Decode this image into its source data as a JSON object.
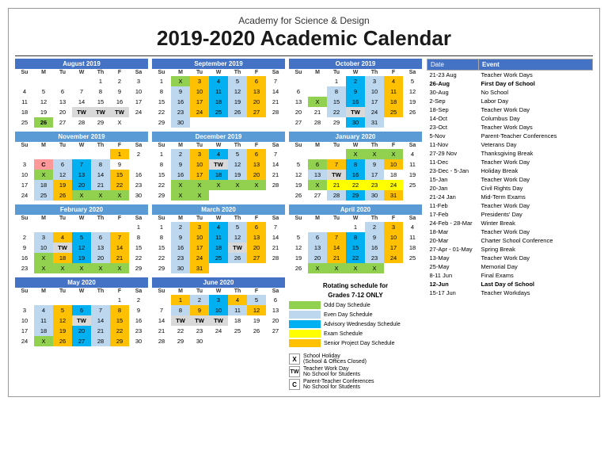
{
  "header": {
    "subtitle": "Academy for Science & Design",
    "title": "2019-2020 Academic Calendar"
  },
  "events": [
    {
      "date": "21-23 Aug",
      "event": "Teacher Work Days",
      "bold": false
    },
    {
      "date": "26-Aug",
      "event": "First Day of School",
      "bold": true
    },
    {
      "date": "30-Aug",
      "event": "No School",
      "bold": false
    },
    {
      "date": "2-Sep",
      "event": "Labor Day",
      "bold": false
    },
    {
      "date": "18-Sep",
      "event": "Teacher Work Day",
      "bold": false
    },
    {
      "date": "14-Oct",
      "event": "Columbus Day",
      "bold": false
    },
    {
      "date": "23-Oct",
      "event": "Teacher Work Days",
      "bold": false
    },
    {
      "date": "5-Nov",
      "event": "Parent-Teacher Conferences",
      "bold": false
    },
    {
      "date": "11-Nov",
      "event": "Veterans Day",
      "bold": false
    },
    {
      "date": "27-29 Nov",
      "event": "Thanksgiving Break",
      "bold": false
    },
    {
      "date": "11-Dec",
      "event": "Teacher Work Day",
      "bold": false
    },
    {
      "date": "23-Dec - 5-Jan",
      "event": "Holiday Break",
      "bold": false
    },
    {
      "date": "15-Jan",
      "event": "Teacher Work Day",
      "bold": false
    },
    {
      "date": "20-Jan",
      "event": "Civil Rights Day",
      "bold": false
    },
    {
      "date": "21-24 Jan",
      "event": "Mid-Term Exams",
      "bold": false
    },
    {
      "date": "11-Feb",
      "event": "Teacher Work Day",
      "bold": false
    },
    {
      "date": "17-Feb",
      "event": "Presidents' Day",
      "bold": false
    },
    {
      "date": "24-Feb - 28-Mar",
      "event": "Winter Break",
      "bold": false
    },
    {
      "date": "18-Mar",
      "event": "Teacher Work Day",
      "bold": false
    },
    {
      "date": "20-Mar",
      "event": "Charter School Conference",
      "bold": false
    },
    {
      "date": "27-Apr - 01-May",
      "event": "Spring Break",
      "bold": false
    },
    {
      "date": "13-May",
      "event": "Teacher Work Day",
      "bold": false
    },
    {
      "date": "25-May",
      "event": "Memorial Day",
      "bold": false
    },
    {
      "date": "8-11 Jun",
      "event": "Final Exams",
      "bold": false
    },
    {
      "date": "12-Jun",
      "event": "Last Day of School",
      "bold": true
    },
    {
      "date": "15-17 Jun",
      "event": "Teacher Workdays",
      "bold": false
    }
  ],
  "legend": {
    "rotating_title": "Rotating schedule for",
    "grades": "Grades 7-12 ONLY",
    "items": [
      {
        "color": "#92D050",
        "label": "Odd Day Schedule"
      },
      {
        "color": "#BDD7EE",
        "label": "Even Day Schedule"
      },
      {
        "color": "#00B0F0",
        "label": "Advisory Wednesday Schedule"
      },
      {
        "color": "#FFFF00",
        "label": "Exam Schedule"
      },
      {
        "color": "#FFC000",
        "label": "Senior Project Day Schedule"
      }
    ]
  },
  "bottom_legend": [
    {
      "symbol": "X",
      "label": "School Holiday\n(School & Offices Closed)"
    },
    {
      "symbol": "TW",
      "label": "Teacher Work Day\nNo School for Students"
    },
    {
      "symbol": "C",
      "label": "Parent-Teacher Conferences\nNo School for Students"
    }
  ],
  "months": {
    "august": {
      "title": "August 2019",
      "days": [
        "Su",
        "M",
        "Tu",
        "W",
        "Th",
        "F",
        "Sa"
      ],
      "rows": [
        [
          "",
          "",
          "",
          "",
          "1",
          "2",
          "3"
        ],
        [
          "4",
          "5",
          "6",
          "7",
          "8",
          "9",
          "10"
        ],
        [
          "11",
          "12",
          "13",
          "14",
          "15",
          "16",
          "17"
        ],
        [
          "18",
          "19",
          "20",
          "TW",
          "TW",
          "TW",
          "24"
        ],
        [
          "25",
          "26",
          "27",
          "28",
          "29",
          "X",
          ""
        ]
      ],
      "highlights": {
        "22": "tw",
        "23": "tw",
        "21": "tw",
        "26": "green"
      }
    },
    "september": {
      "title": "September 2019"
    },
    "october": {
      "title": "October 2019"
    },
    "november": {
      "title": "November 2019"
    },
    "december": {
      "title": "December 2019"
    },
    "january": {
      "title": "January 2020"
    }
  }
}
